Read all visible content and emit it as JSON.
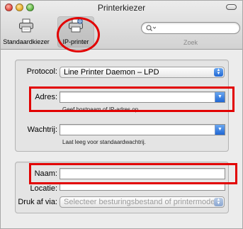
{
  "window": {
    "title": "Printerkiezer"
  },
  "toolbar": {
    "items": [
      {
        "label": "Standaardkiezer",
        "icon": "printer-icon"
      },
      {
        "label": "IP-printer",
        "icon": "ip-printer-icon"
      }
    ],
    "search": {
      "placeholder": "",
      "caption": "Zoek"
    }
  },
  "form": {
    "protocol": {
      "label": "Protocol:",
      "value": "Line Printer Daemon – LPD"
    },
    "address": {
      "label": "Adres:",
      "value": "",
      "hint": "Geef hostnaam of IP-adres op."
    },
    "queue": {
      "label": "Wachtrij:",
      "value": "",
      "hint": "Laat leeg voor standaardwachtrij."
    },
    "name": {
      "label": "Naam:",
      "value": ""
    },
    "location": {
      "label": "Locatie:",
      "value": ""
    },
    "print_via": {
      "label": "Druk af via:",
      "value": "Selecteer besturingsbestand of printermodel"
    }
  },
  "colors": {
    "callout": "#e20000",
    "accent": "#1f67d4"
  }
}
